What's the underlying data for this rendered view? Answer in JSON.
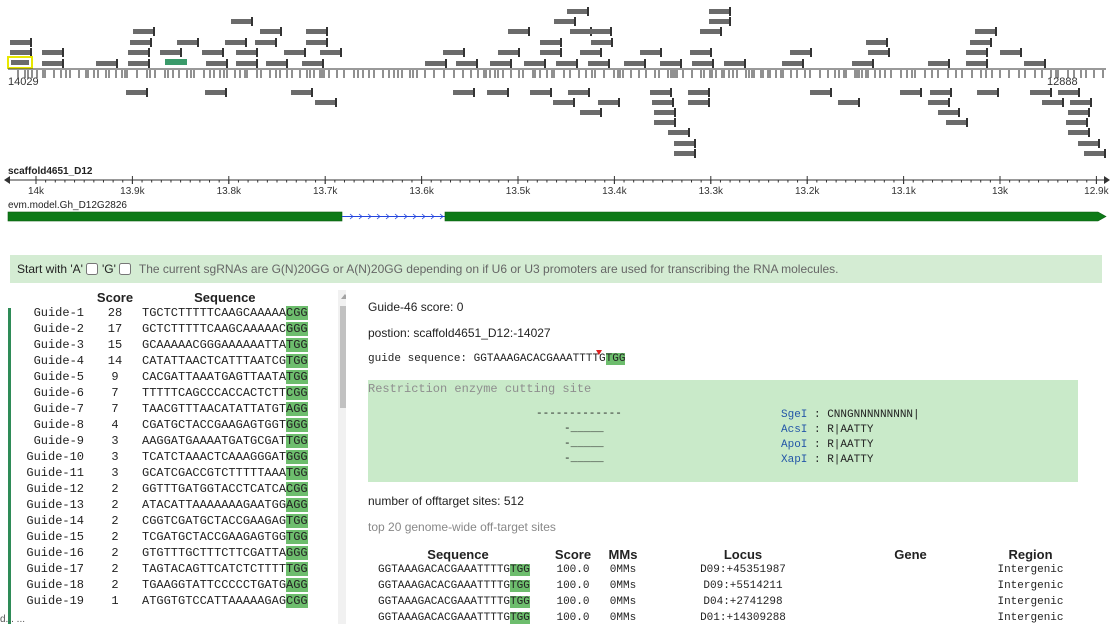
{
  "genome": {
    "start_label": "14029",
    "end_label": "12888",
    "scaffold": "scaffold4651_D12",
    "gene_model": "evm.model.Gh_D12G2826",
    "axis_ticks": [
      "14k",
      "13.9k",
      "13.8k",
      "13.7k",
      "13.6k",
      "13.5k",
      "13.4k",
      "13.3k",
      "13.2k",
      "13.1k",
      "13k",
      "12.9k"
    ],
    "colors": {
      "guide": "#6b6b6b",
      "selected_outline": "#e8e800",
      "active_guide": "#3a9a6a",
      "gene": "#0d7a17",
      "intron": "#2244dd"
    }
  },
  "toolbar": {
    "start_with_label": "Start with 'A'",
    "g_label": "'G'",
    "hint": "The current sgRNAs are G(N)20GG or A(N)20GG depending on if U6 or U3 promoters are used for transcribing the RNA molecules."
  },
  "guides": {
    "header_score": "Score",
    "header_sequence": "Sequence",
    "rows": [
      {
        "name": "Guide-1",
        "score": "28",
        "seq": "TGCTCTTTTTCAAGCAAAAA",
        "pam": "CGG"
      },
      {
        "name": "Guide-2",
        "score": "17",
        "seq": "GCTCTTTTTCAAGCAAAAAC",
        "pam": "GGG"
      },
      {
        "name": "Guide-3",
        "score": "15",
        "seq": "GCAAAAACGGGAAAAAATTA",
        "pam": "TGG"
      },
      {
        "name": "Guide-4",
        "score": "14",
        "seq": "CATATTAACTCATTTAATCG",
        "pam": "TGG"
      },
      {
        "name": "Guide-5",
        "score": "9",
        "seq": "CACGATTAAATGAGTTAATA",
        "pam": "TGG"
      },
      {
        "name": "Guide-6",
        "score": "7",
        "seq": "TTTTTCAGCCCACCACTCTT",
        "pam": "CGG"
      },
      {
        "name": "Guide-7",
        "score": "7",
        "seq": "TAACGTTTAACATATTATGT",
        "pam": "AGG"
      },
      {
        "name": "Guide-8",
        "score": "4",
        "seq": "CGATGCTACCGAAGAGTGGT",
        "pam": "GGG"
      },
      {
        "name": "Guide-9",
        "score": "3",
        "seq": "AAGGATGAAAATGATGCGAT",
        "pam": "TGG"
      },
      {
        "name": "Guide-10",
        "score": "3",
        "seq": "TCATCTAAACTCAAAGGGAT",
        "pam": "GGG"
      },
      {
        "name": "Guide-11",
        "score": "3",
        "seq": "GCATCGACCGTCTTTTTAAA",
        "pam": "TGG"
      },
      {
        "name": "Guide-12",
        "score": "2",
        "seq": "GGTTTGATGGTACCTCATCA",
        "pam": "CGG"
      },
      {
        "name": "Guide-13",
        "score": "2",
        "seq": "ATACATTAAAAAAAGAATGG",
        "pam": "AGG"
      },
      {
        "name": "Guide-14",
        "score": "2",
        "seq": "CGGTCGATGCTACCGAAGAG",
        "pam": "TGG"
      },
      {
        "name": "Guide-15",
        "score": "2",
        "seq": "TCGATGCTACCGAAGAGTGG",
        "pam": "TGG"
      },
      {
        "name": "Guide-16",
        "score": "2",
        "seq": "GTGTTTGCTTTCTTCGATTA",
        "pam": "GGG"
      },
      {
        "name": "Guide-17",
        "score": "2",
        "seq": "TAGTACAGTTCATCTCTTTT",
        "pam": "TGG"
      },
      {
        "name": "Guide-18",
        "score": "2",
        "seq": "TGAAGGTATTCCCCCTGATG",
        "pam": "AGG"
      },
      {
        "name": "Guide-19",
        "score": "1",
        "seq": "ATGGTGTCCATTAAAAAGAG",
        "pam": "CGG"
      }
    ]
  },
  "detail": {
    "score_line": "Guide-46 score: 0",
    "position_line": "postion: scaffold4651_D12:-14027",
    "guide_label": "guide sequence: ",
    "guide_seq": "GGTAAAGACACGAAATTTTG",
    "guide_pam": "TGG",
    "restriction_title": "Restriction enzyme cutting site",
    "enzymes": [
      {
        "site": "-------------",
        "name": "SgeI",
        "motif": " : CNNGNNNNNNNNN|"
      },
      {
        "site": "-_____",
        "name": "AcsI",
        "motif": " : R|AATTY"
      },
      {
        "site": "-_____",
        "name": "ApoI",
        "motif": " : R|AATTY"
      },
      {
        "site": "-_____",
        "name": "XapI",
        "motif": " : R|AATTY"
      }
    ],
    "offtarget_count": "number of offtarget sites: 512",
    "top_label": "top 20 genome-wide off-target sites",
    "off_headers": [
      "Sequence",
      "Score",
      "MMs",
      "Locus",
      "Gene",
      "Region"
    ],
    "off_rows": [
      {
        "seq": "GGTAAAGACACGAAATTTTG",
        "pam": "TGG",
        "score": "100.0",
        "mms": "0MMs",
        "locus": "D09:+45351987",
        "gene": "",
        "region": "Intergenic"
      },
      {
        "seq": "GGTAAAGACACGAAATTTTG",
        "pam": "TGG",
        "score": "100.0",
        "mms": "0MMs",
        "locus": "D09:+5514211",
        "gene": "",
        "region": "Intergenic"
      },
      {
        "seq": "GGTAAAGACACGAAATTTTG",
        "pam": "TGG",
        "score": "100.0",
        "mms": "0MMs",
        "locus": "D04:+2741298",
        "gene": "",
        "region": "Intergenic"
      },
      {
        "seq": "GGTAAAGACACGAAATTTTG",
        "pam": "TGG",
        "score": "100.0",
        "mms": "0MMs",
        "locus": "D01:+14309288",
        "gene": "",
        "region": "Intergenic"
      }
    ]
  },
  "footer": {
    "corner_text": "d... ..."
  }
}
